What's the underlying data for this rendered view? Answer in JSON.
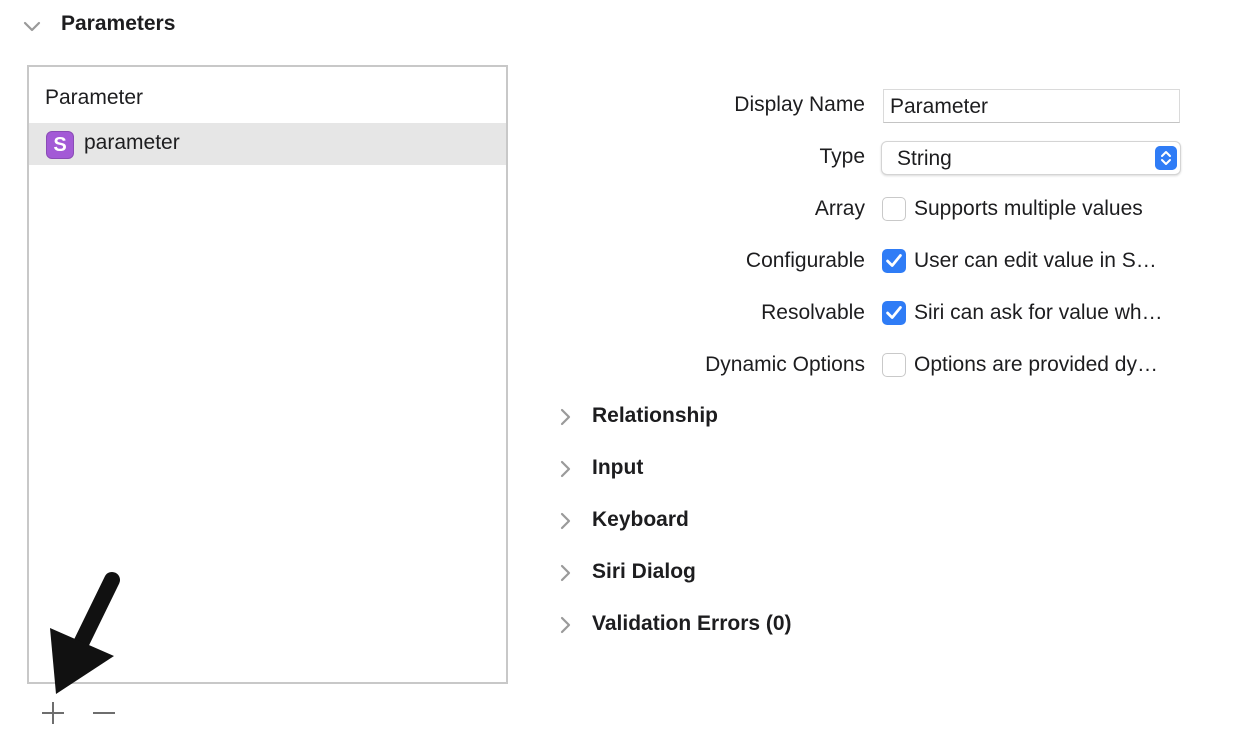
{
  "section": {
    "title": "Parameters",
    "expanded": true
  },
  "parameter_list": {
    "header": "Parameter",
    "items": [
      {
        "badge": "S",
        "label": "parameter",
        "selected": true
      }
    ],
    "add_icon": "plus-icon",
    "remove_icon": "minus-icon"
  },
  "form": {
    "display_name": {
      "label": "Display Name",
      "value": "Parameter"
    },
    "type": {
      "label": "Type",
      "value": "String"
    },
    "array": {
      "label": "Array",
      "option": "Supports multiple values",
      "checked": false
    },
    "configurable": {
      "label": "Configurable",
      "option": "User can edit value in S…",
      "checked": true
    },
    "resolvable": {
      "label": "Resolvable",
      "option": "Siri can ask for value wh…",
      "checked": true
    },
    "dynamic_options": {
      "label": "Dynamic Options",
      "option": "Options are provided dy…",
      "checked": false
    }
  },
  "sections": [
    {
      "label": "Relationship"
    },
    {
      "label": "Input"
    },
    {
      "label": "Keyboard"
    },
    {
      "label": "Siri Dialog"
    },
    {
      "label": "Validation Errors (0)"
    }
  ],
  "colors": {
    "accent": "#2f7cf6",
    "badge": "#a35ad6",
    "selection": "#e6e6e6"
  }
}
